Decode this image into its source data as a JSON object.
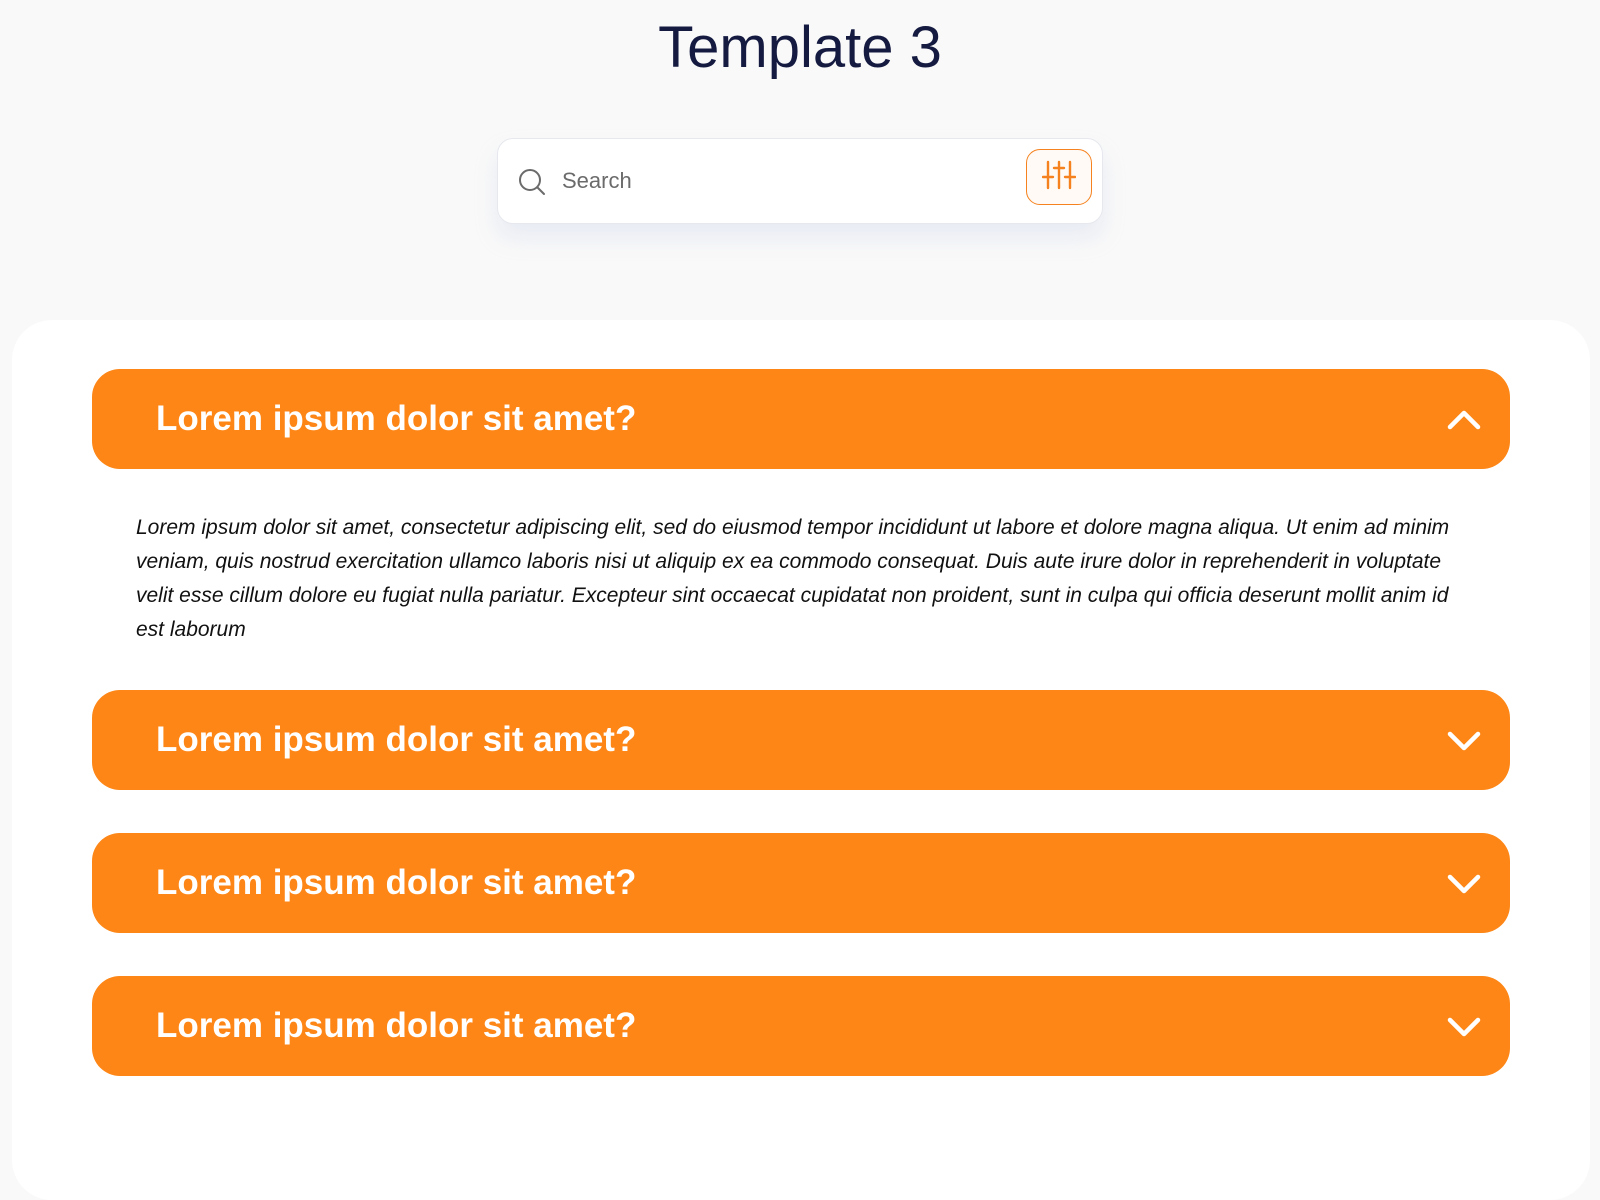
{
  "page": {
    "title": "Template 3"
  },
  "search": {
    "placeholder": "Search",
    "value": "",
    "search_icon": "search-icon",
    "filter_icon": "sliders-icon"
  },
  "colors": {
    "accent": "#fd8616",
    "title": "#141a40",
    "background": "#f9f9f9",
    "card": "#ffffff"
  },
  "faq": {
    "items": [
      {
        "question": "Lorem ipsum dolor sit amet?",
        "expanded": true,
        "chevron": "chevron-up-icon",
        "answer": "Lorem ipsum dolor sit amet, consectetur adipiscing elit, sed do eiusmod tempor incididunt ut labore et dolore magna aliqua. Ut enim ad minim veniam, quis nostrud exercitation ullamco laboris nisi ut aliquip ex ea commodo consequat. Duis aute irure dolor in reprehenderit in voluptate velit esse cillum dolore eu fugiat nulla pariatur. Excepteur sint occaecat cupidatat non proident, sunt in culpa qui officia deserunt mollit anim id est laborum"
      },
      {
        "question": "Lorem ipsum dolor sit amet?",
        "expanded": false,
        "chevron": "chevron-down-icon"
      },
      {
        "question": "Lorem ipsum dolor sit amet?",
        "expanded": false,
        "chevron": "chevron-down-icon"
      },
      {
        "question": "Lorem ipsum dolor sit amet?",
        "expanded": false,
        "chevron": "chevron-down-icon"
      }
    ]
  }
}
